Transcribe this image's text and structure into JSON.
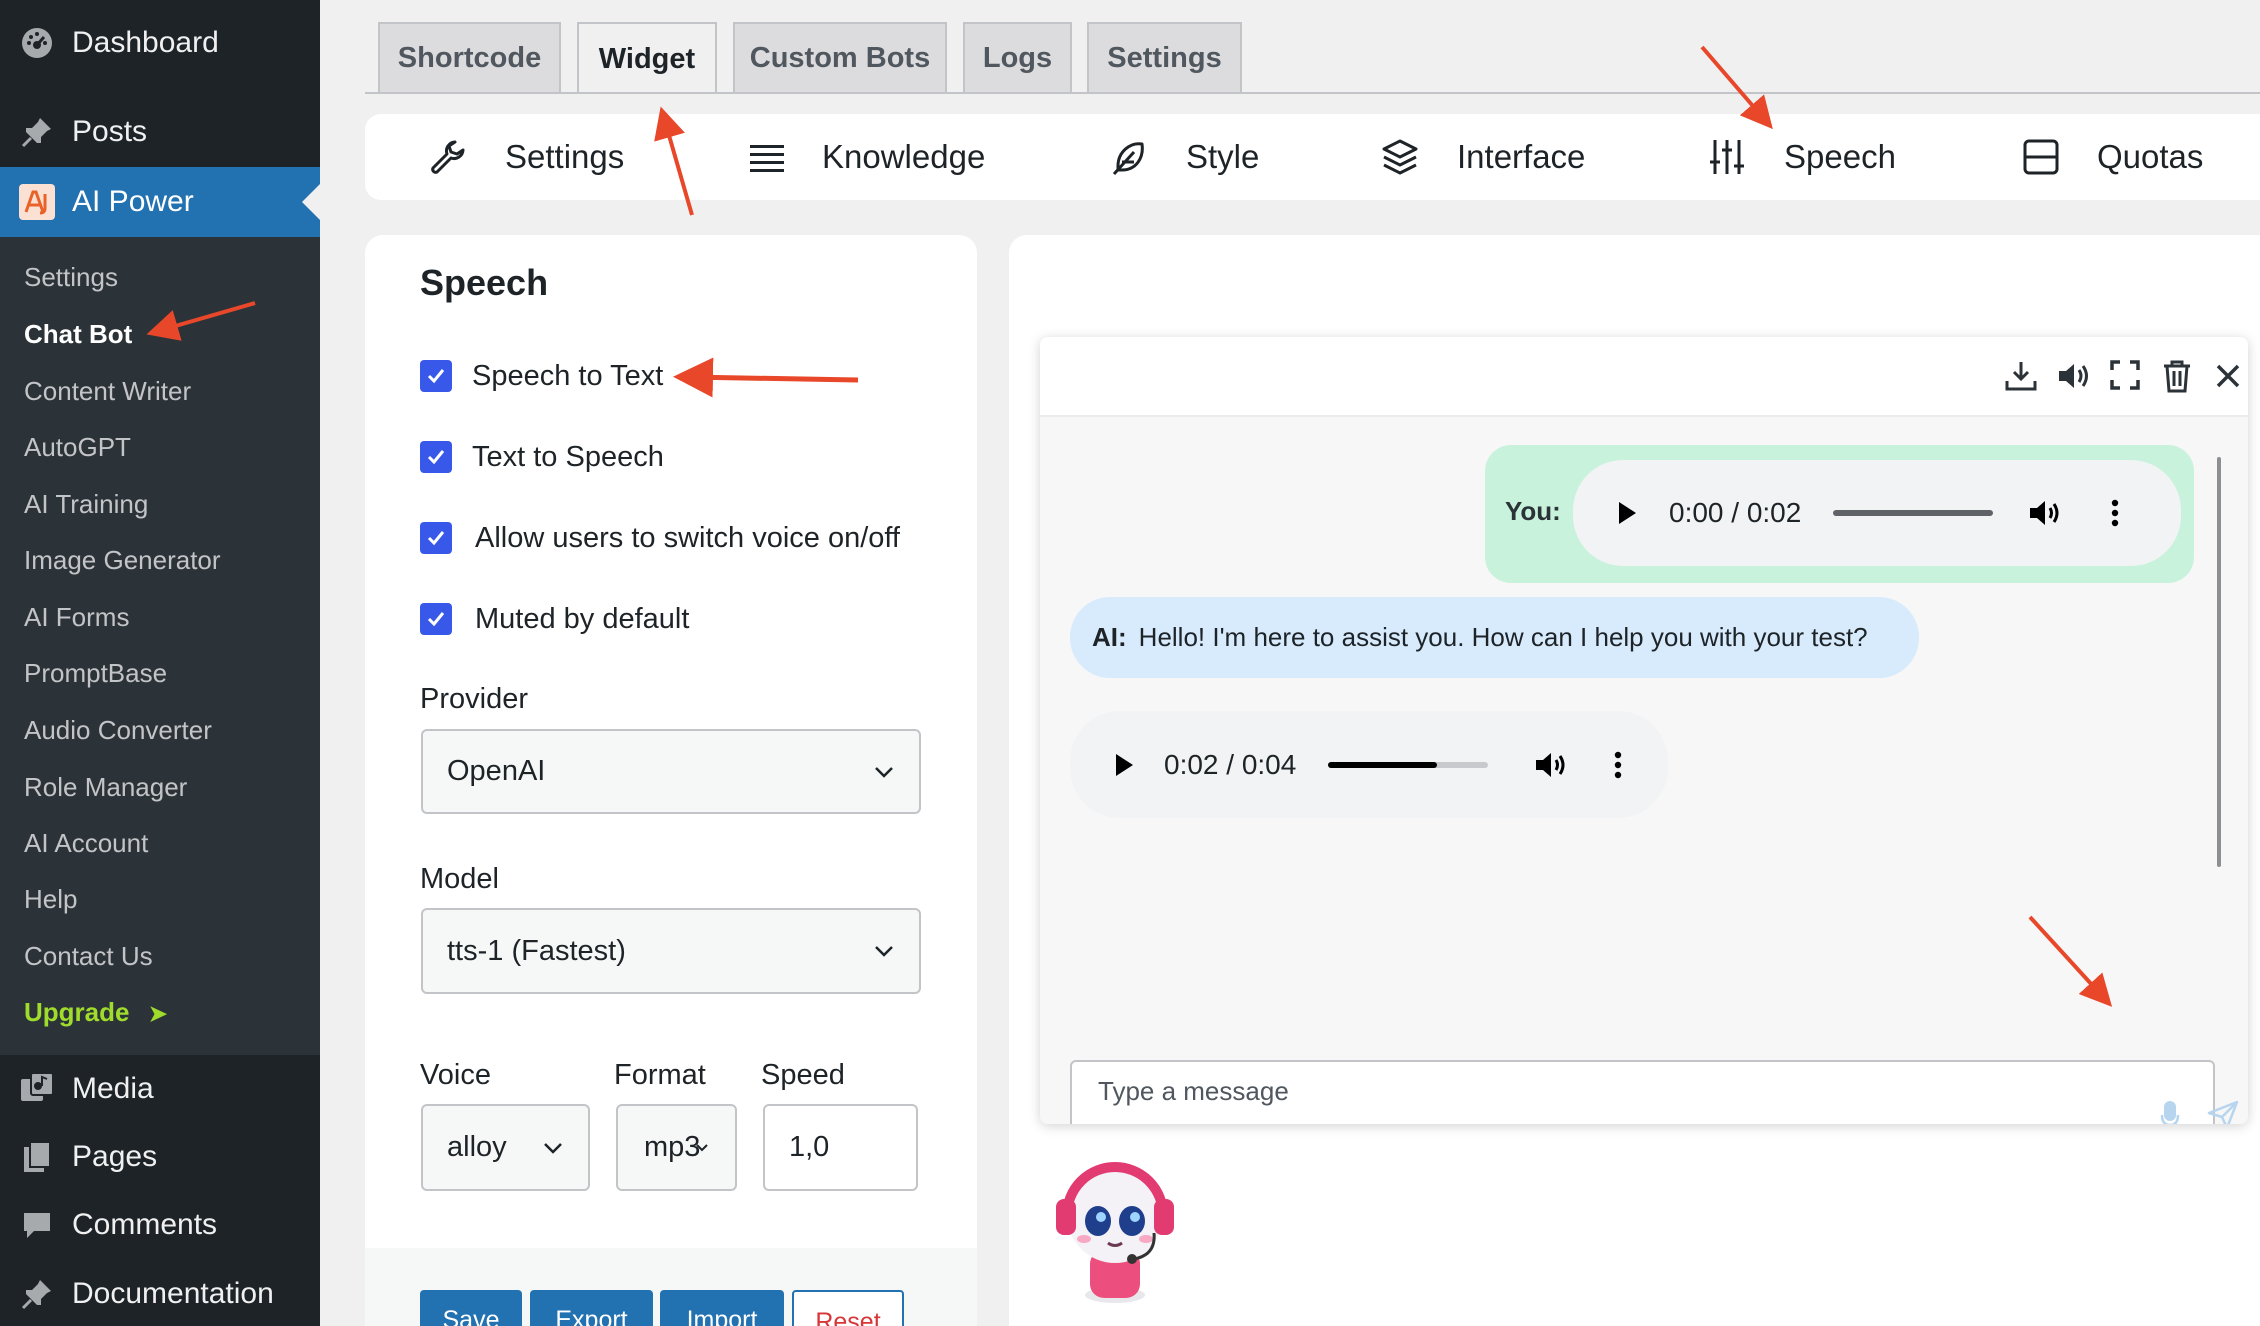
{
  "sidebar": {
    "top": [
      {
        "name": "dashboard",
        "label": "Dashboard"
      },
      {
        "name": "posts",
        "label": "Posts"
      },
      {
        "name": "ai-power",
        "label": "AI Power"
      }
    ],
    "submenu": [
      "Settings",
      "Chat Bot",
      "Content Writer",
      "AutoGPT",
      "AI Training",
      "Image Generator",
      "AI Forms",
      "PromptBase",
      "Audio Converter",
      "Role Manager",
      "AI Account",
      "Help",
      "Contact Us"
    ],
    "upgrade": "Upgrade",
    "upgrade_icon": "➤",
    "bottom": [
      {
        "name": "media",
        "label": "Media"
      },
      {
        "name": "pages",
        "label": "Pages"
      },
      {
        "name": "comments",
        "label": "Comments"
      },
      {
        "name": "documentation",
        "label": "Documentation"
      }
    ],
    "current_item": "Chat Bot"
  },
  "tabs": [
    "Shortcode",
    "Widget",
    "Custom Bots",
    "Logs",
    "Settings"
  ],
  "active_tab": "Widget",
  "subnav": [
    {
      "label": "Settings",
      "icon": "wrench-icon"
    },
    {
      "label": "Knowledge",
      "icon": "list-icon"
    },
    {
      "label": "Style",
      "icon": "feather-icon"
    },
    {
      "label": "Interface",
      "icon": "layers-icon"
    },
    {
      "label": "Speech",
      "icon": "sliders-icon"
    },
    {
      "label": "Quotas",
      "icon": "box-icon"
    }
  ],
  "speech": {
    "title": "Speech",
    "options": [
      {
        "label": "Speech to Text",
        "checked": true
      },
      {
        "label": "Text to Speech",
        "checked": true
      },
      {
        "label": "Allow users to switch voice on/off",
        "checked": true
      },
      {
        "label": "Muted by default",
        "checked": true
      }
    ],
    "provider_label": "Provider",
    "provider_value": "OpenAI",
    "model_label": "Model",
    "model_value": "tts-1 (Fastest)",
    "voice_label": "Voice",
    "voice_value": "alloy",
    "format_label": "Format",
    "format_value": "mp3",
    "speed_label": "Speed",
    "speed_value": "1,0"
  },
  "buttons": {
    "save": "Save",
    "export": "Export",
    "import": "Import",
    "reset": "Reset"
  },
  "chat": {
    "user_label": "You:",
    "user_audio_time": "0:00 / 0:02",
    "user_audio_progress": 0.0,
    "ai_label": "AI:",
    "ai_message": "Hello! I'm here to assist you. How can I help you with your test?",
    "ai_audio_time": "0:02 / 0:04",
    "ai_audio_progress": 0.68,
    "input_placeholder": "Type a message",
    "header_icons": [
      "download-icon",
      "volume-icon",
      "fullscreen-icon",
      "trash-icon",
      "close-icon"
    ]
  },
  "colors": {
    "sidebar_bg": "#1d2327",
    "submenu_bg": "#2c3338",
    "accent": "#2271b1",
    "checkbox": "#3858e9",
    "upgrade": "#9fdc2b",
    "user_bubble": "#c8f2dc",
    "ai_bubble": "#d7ebfd",
    "annotation_arrow": "#e8472a",
    "reset_text": "#d63638"
  }
}
